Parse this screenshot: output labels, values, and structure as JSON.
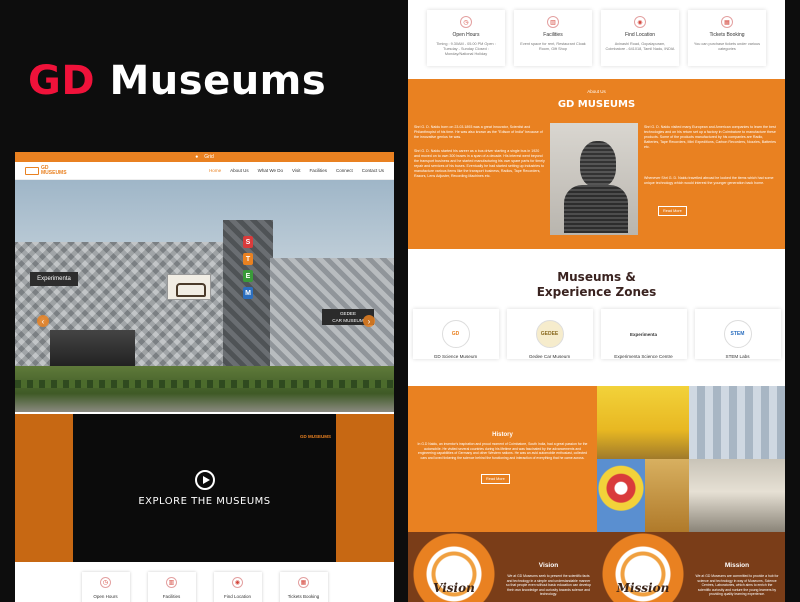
{
  "banner": {
    "brand_accent": "GD",
    "brand_rest": " Museums",
    "accent_color": "#f0123a"
  },
  "site": {
    "topbar_text": "Grid",
    "logo_line1": "GD",
    "logo_line2": "MUSEUMS",
    "nav": [
      "Home",
      "About Us",
      "What We Do",
      "Visit",
      "Facilities",
      "Connect",
      "Contact Us"
    ],
    "hero_signs": {
      "experimenta": "Experimenta",
      "geder1": "GEDEE",
      "geder2": "CAR MUSEUM",
      "stem_letters": [
        "S",
        "T",
        "E",
        "M"
      ]
    },
    "explore_label": "EXPLORE THE MUSEUMS",
    "video_logo": "GD MUSEUMS",
    "bottom_cards": [
      "Open Hours",
      "Facilities",
      "Find Location",
      "Tickets Booking"
    ]
  },
  "info_cards": [
    {
      "title": "Open Hours",
      "text": "Timing : 9.30AM - 05.00 PM Open : Tuesday - Sunday Closed : Monday/National Holiday",
      "icon": "clock-icon"
    },
    {
      "title": "Facilities",
      "text": "Event space for rent, Restaurant Cloak Room, Gift Shop",
      "icon": "building-icon"
    },
    {
      "title": "Find Location",
      "text": "Avinashi Road, Gopalapuram, Coimbatore - 641018, Tamil Nadu, INDIA",
      "icon": "location-icon"
    },
    {
      "title": "Tickets Booking",
      "text": "You can purchase tickets under various categories",
      "icon": "ticket-icon"
    }
  ],
  "about": {
    "kicker": "About Us",
    "heading": "GD MUSEUMS",
    "p1": "Shri G. D. Naidu born on 23.03.1893 was a great Innovator, Scientist and Philanthropist of his time. He was also known as the \"Edison of India\" because of the innovative genius he was.",
    "p2": "Shri G. D. Naidu started his career as a bus driver starting a single bus in 1920 and moved on to own 300 buses in a span of a decade. His interest went beyond the transport business and he started manufacturing his own spare parts for timely repair and services of his buses. Eventually he had started setting up industries to manufacture various items like the transport business, Radios, Tape Recorders, Razors, Lens Adjuster, Recording Machines etc.",
    "p3": "Shri G. D. Naidu visited many European and American companies to learn the best technologies and on his return set up a factory in Coimbatore to manufacture these products. Some of the products manufactured by his companies are Radio, Batteries, Tape Recorders, Mini Expeditions, Carbon Recorders, Nozzles, Batteries etc.",
    "p4": "Whenever Shri G. D. Naidu travelled abroad he looked the items which had some unique technology which would interest the younger generation back home.",
    "read_more": "Read More"
  },
  "zones": {
    "heading_line1": "Museums &",
    "heading_line2": "Experience Zones",
    "items": [
      {
        "label": "GD Science Museum",
        "logo": "GD"
      },
      {
        "label": "Gedee Car Museum",
        "logo": "GEDEE"
      },
      {
        "label": "Experimenta Science Centre",
        "logo": "Experimenta"
      },
      {
        "label": "STEM Labs",
        "logo": "STEM"
      }
    ]
  },
  "history": {
    "heading": "History",
    "text": "In G.D Naidu, an inventor's inspiration and proud moment of Coimbatore, South India, had a great passion for the automobile. He visited several countries during his lifetime and was fascinated by the advancements and engineering capabilities of Germany and other Western nations. He was an avid automobile enthusiast, collected cars and loved tinkering the science behind the functioning and interaction of everything that he came across.",
    "read_more": "Read More"
  },
  "vision": {
    "heading": "Vision",
    "word": "Vision",
    "text": "We at GD Museums seek to present the scientific facts and technology in a simple and understandable manner so that people even without basic education can develop their own knowledge and curiosity towards science and technology."
  },
  "mission": {
    "heading": "Mission",
    "word": "Mission",
    "text": "We at GD Museums are committed to provide a hub for science and technology in way of Museums, Science Centres, Laboratories, which aims to enrich the scientific curiosity and nurture the young learners by providing quality learning experience."
  }
}
